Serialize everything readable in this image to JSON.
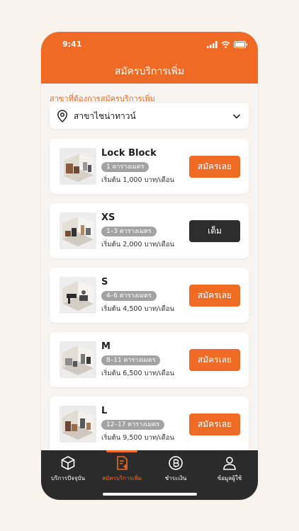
{
  "status_bar": {
    "time": "9:41"
  },
  "header": {
    "title": "สมัครบริการเพิ่ม"
  },
  "branch": {
    "label": "สาขาที่ต้องการสมัครบริการเพิ่ม",
    "value": "สาขาไชน่าทาวน์"
  },
  "units": [
    {
      "name": "Lock Block",
      "size": "1 ตารางเมตร",
      "price": "เริ่มต้น 1,000 บาท/เดือน",
      "action": "สมัครเลย",
      "status": "available"
    },
    {
      "name": "XS",
      "size": "1–3 ตารางเมตร",
      "price": "เริ่มต้น 2,000 บาท/เดือน",
      "action": "เต็ม",
      "status": "full"
    },
    {
      "name": "S",
      "size": "4–6 ตารางเมตร",
      "price": "เริ่มต้น 4,500 บาท/เดือน",
      "action": "สมัครเลย",
      "status": "available"
    },
    {
      "name": "M",
      "size": "8–11 ตารางเมตร",
      "price": "เริ่มต้น 6,500 บาท/เดือน",
      "action": "สมัครเลย",
      "status": "available"
    },
    {
      "name": "L",
      "size": "12–17 ตารางเมตร",
      "price": "เริ่มต้น 9,500 บาท/เดือน",
      "action": "สมัครเลย",
      "status": "available"
    }
  ],
  "tabs": [
    {
      "label": "บริการปัจจุบัน",
      "icon": "box-icon"
    },
    {
      "label": "สมัครบริการเพิ่ม",
      "icon": "add-document-icon",
      "active": true
    },
    {
      "label": "ชำระเงิน",
      "icon": "baht-coin-icon"
    },
    {
      "label": "ข้อมูลผู้ใช้",
      "icon": "user-icon"
    }
  ],
  "colors": {
    "accent": "#ef6a25",
    "dark": "#2d2d2d",
    "badge": "#a3a3a3",
    "background": "#f8f3ec"
  }
}
